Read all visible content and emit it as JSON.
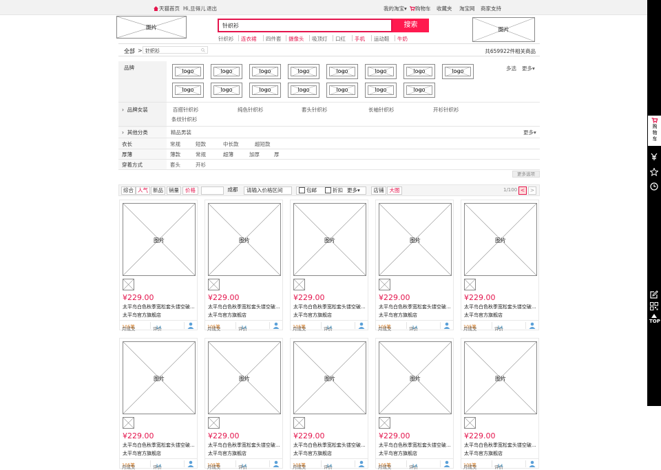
{
  "topbar": {
    "home": "天猫首页",
    "greeting": "Hi,旦得儿",
    "logout": "退出",
    "my_taobao": "我的淘宝",
    "cart": "购物车",
    "favorites": "收藏夹",
    "taobao": "淘宝网",
    "merchant": "商家支持"
  },
  "header": {
    "left_placeholder": "图片",
    "right_placeholder": "图片",
    "search_value": "针织衫",
    "search_button": "搜索"
  },
  "hotwords": [
    {
      "text": "针织衫",
      "red": false
    },
    {
      "text": "连衣裙",
      "red": true
    },
    {
      "text": "四件套",
      "red": false
    },
    {
      "text": "摄像头",
      "red": true
    },
    {
      "text": "吸顶灯",
      "red": false
    },
    {
      "text": "口红",
      "red": false
    },
    {
      "text": "手机",
      "red": true
    },
    {
      "text": "运动鞋",
      "red": false
    },
    {
      "text": "牛奶",
      "red": true
    }
  ],
  "crumb": {
    "all": "全部",
    "sep": ">",
    "tag": "针织衫",
    "count": "共659922件相关商品"
  },
  "brand": {
    "label": "品牌",
    "logo_text": "logo",
    "multi": "多选",
    "more": "更多"
  },
  "categories": {
    "label": "品牌女装",
    "items": [
      "百搭针织衫",
      "纯色针织衫",
      "套头针织衫",
      "长袖针织衫",
      "开衫针织衫",
      "条纹针织衫"
    ]
  },
  "other_cat": {
    "label": "其他分类",
    "items": [
      "精品男装"
    ],
    "more": "更多"
  },
  "attrs": [
    {
      "label": "衣长",
      "items": [
        "常规",
        "短款",
        "中长款",
        "超短款"
      ]
    },
    {
      "label": "厚薄",
      "items": [
        "薄款",
        "常规",
        "超薄",
        "加厚",
        "厚"
      ]
    },
    {
      "label": "穿着方式",
      "items": [
        "套头",
        "开衫"
      ]
    }
  ],
  "more_options": "更多选项",
  "sortbar": {
    "comprehensive": "综合",
    "popular": "人气",
    "new": "新品",
    "sales": "销量",
    "price": "价格",
    "price_placeholder": "成都",
    "price_range": "请输入价格区间",
    "package": "包邮",
    "discount": "折扣",
    "more": "更多",
    "shop": "店铺",
    "big": "大图",
    "page": "1/100",
    "prev": "<",
    "next": ">"
  },
  "product": {
    "img": "图片",
    "price": "¥229.00",
    "title": "太平鸟白色秋季宽松套头镂空破...",
    "shop": "太平鸟官方旗舰店",
    "sales_label": "月成交",
    "sales": "105笔",
    "review_label": "评价",
    "reviews": "14"
  },
  "sidebar": {
    "cart": "购物车",
    "top": "TOP"
  }
}
